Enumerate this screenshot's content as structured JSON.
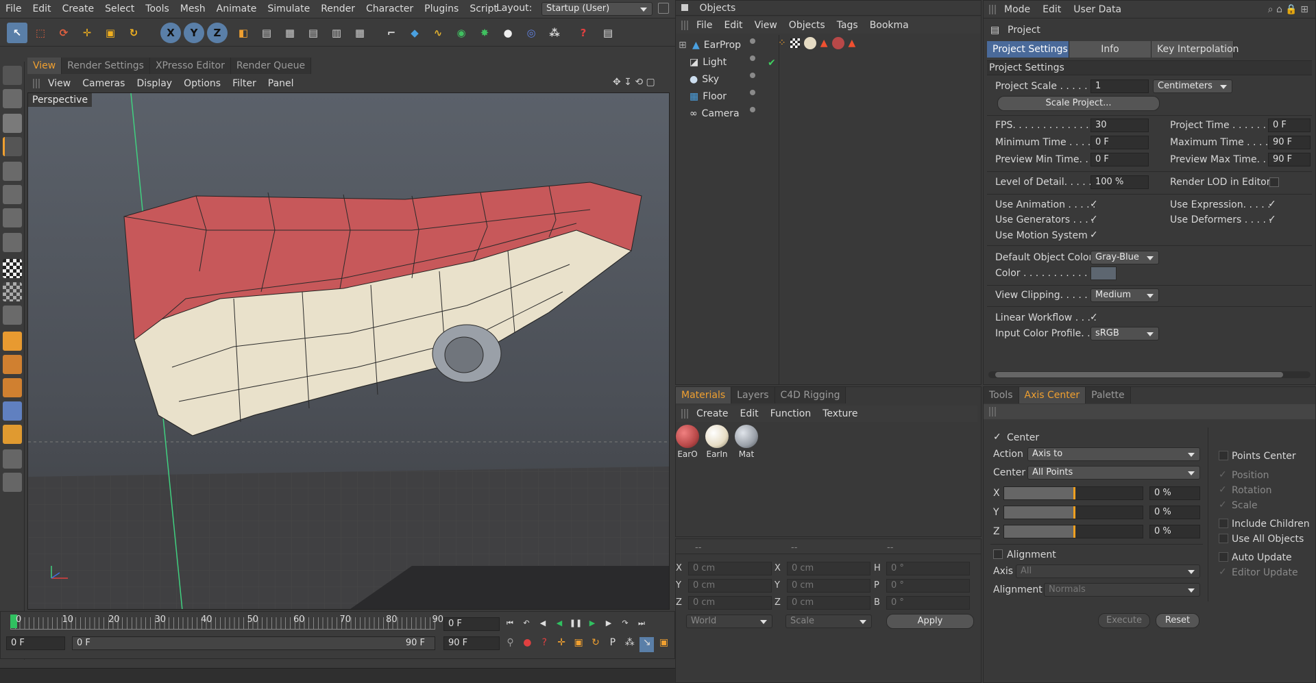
{
  "menu": [
    "File",
    "Edit",
    "Create",
    "Select",
    "Tools",
    "Mesh",
    "Animate",
    "Simulate",
    "Render",
    "Character",
    "Plugins",
    "Script"
  ],
  "layout": {
    "label": "Layout:",
    "value": "Startup (User)"
  },
  "viewport_tabs": [
    "View",
    "Render Settings",
    "XPresso Editor",
    "Render Queue"
  ],
  "viewport_menu": [
    "View",
    "Cameras",
    "Display",
    "Options",
    "Filter",
    "Panel"
  ],
  "viewport_label": "Perspective",
  "objects_panel": {
    "title": "Objects",
    "menu": [
      "File",
      "Edit",
      "View",
      "Objects",
      "Tags",
      "Bookma"
    ],
    "items": [
      "EarProp",
      "Light",
      "Sky",
      "Floor",
      "Camera"
    ]
  },
  "materials_panel": {
    "tabs": [
      "Materials",
      "Layers",
      "C4D Rigging"
    ],
    "menu": [
      "Create",
      "Edit",
      "Function",
      "Texture"
    ],
    "materials": [
      {
        "name": "EarO",
        "color": "#b84848"
      },
      {
        "name": "EarIn",
        "color": "#e6dcc4"
      },
      {
        "name": "Mat",
        "color": "#9aa0a8"
      }
    ]
  },
  "coords": {
    "header": [
      "--",
      "--",
      "--"
    ],
    "rows": [
      {
        "a": "X",
        "av": "0 cm",
        "b": "X",
        "bv": "0 cm",
        "c": "H",
        "cv": "0 °"
      },
      {
        "a": "Y",
        "av": "0 cm",
        "b": "Y",
        "bv": "0 cm",
        "c": "P",
        "cv": "0 °"
      },
      {
        "a": "Z",
        "av": "0 cm",
        "b": "Z",
        "bv": "0 cm",
        "c": "B",
        "cv": "0 °"
      }
    ],
    "world": "World",
    "scale": "Scale",
    "apply": "Apply"
  },
  "attr_panel": {
    "menu": [
      "Mode",
      "Edit",
      "User Data"
    ],
    "title": "Project",
    "tabs": [
      "Project Settings",
      "Info",
      "Key Interpolation"
    ],
    "section": "Project Settings",
    "project_scale": {
      "label": "Project Scale . . . . . . .",
      "value": "1",
      "unit": "Centimeters"
    },
    "scale_button": "Scale Project...",
    "fps": {
      "label": "FPS. . . . . . . . . . . . . . . .",
      "value": "30"
    },
    "project_time": {
      "label": "Project Time . . . . . . .",
      "value": "0 F"
    },
    "min_time": {
      "label": "Minimum Time . . . . .",
      "value": "0 F"
    },
    "max_time": {
      "label": "Maximum Time . . . .",
      "value": "90 F"
    },
    "prev_min": {
      "label": "Preview Min Time. . .",
      "value": "0 F"
    },
    "prev_max": {
      "label": "Preview Max Time. . .",
      "value": "90 F"
    },
    "lod": {
      "label": "Level of Detail. . . . . .",
      "value": "100 %"
    },
    "render_lod": "Render LOD in Editor",
    "use_animation": "Use Animation . . . . .",
    "use_expression": "Use Expression. . . . .",
    "use_generators": "Use Generators . . . .",
    "use_deformers": "Use Deformers . . . . .",
    "use_motion": "Use Motion System",
    "def_color": {
      "label": "Default Object Color",
      "value": "Gray-Blue"
    },
    "color": {
      "label": "Color . . . . . . . . . . . . ."
    },
    "clipping": {
      "label": "View Clipping. . . . . .",
      "value": "Medium"
    },
    "linear": "Linear Workflow . . . .",
    "input_profile": {
      "label": "Input Color Profile. . .",
      "value": "sRGB"
    }
  },
  "tool_panel": {
    "tabs": [
      "Tools",
      "Axis Center",
      "Palette"
    ],
    "center": "Center",
    "action": {
      "label": "Action",
      "value": "Axis to"
    },
    "center_sel": {
      "label": "Center",
      "value": "All Points"
    },
    "sliders": [
      {
        "axis": "X",
        "value": "0 %",
        "level": 0.5
      },
      {
        "axis": "Y",
        "value": "0 %",
        "level": 0.5
      },
      {
        "axis": "Z",
        "value": "0 %",
        "level": 0.5
      }
    ],
    "alignment_chk": "Alignment",
    "axis": {
      "label": "Axis",
      "value": "All"
    },
    "alignment": {
      "label": "Alignment",
      "value": "Normals"
    },
    "right_opts": [
      "Points Center",
      "Position",
      "Rotation",
      "Scale",
      "Include Children",
      "Use All Objects",
      "Auto Update",
      "Editor Update"
    ],
    "execute": "Execute",
    "reset": "Reset"
  },
  "timeline": {
    "ticks": [
      "0",
      "10",
      "20",
      "30",
      "40",
      "50",
      "60",
      "70",
      "80",
      "90"
    ],
    "current": "0 F",
    "start": "0 F",
    "range_start": "0 F",
    "range_end": "90 F",
    "end": "90 F"
  }
}
